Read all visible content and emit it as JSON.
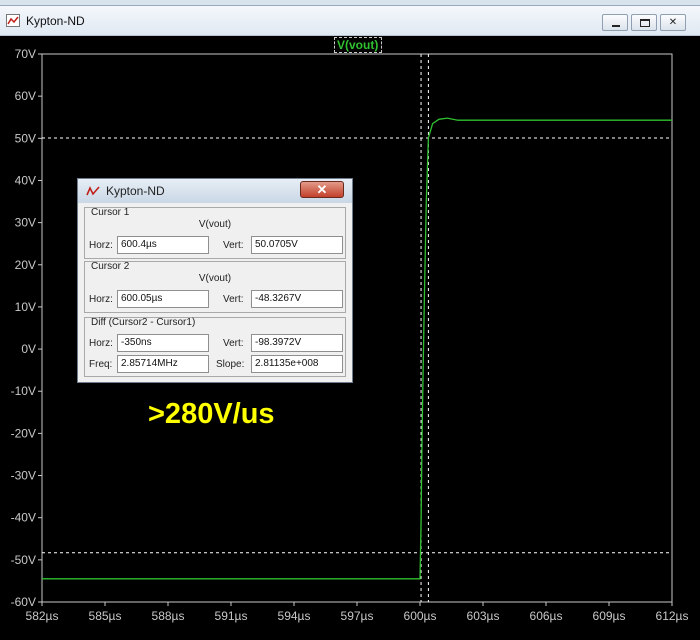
{
  "window": {
    "title": "Kypton-ND"
  },
  "window_buttons": {
    "minimize": "",
    "maximize": "",
    "close": "✕"
  },
  "trace_label": "V(vout)",
  "annotation": ">280V/us",
  "cursor_dialog": {
    "title": "Kypton-ND",
    "close_label": "✕",
    "cursor1": {
      "title": "Cursor 1",
      "trace": "V(vout)",
      "horz_label": "Horz:",
      "horz": "600.4µs",
      "vert_label": "Vert:",
      "vert": "50.0705V"
    },
    "cursor2": {
      "title": "Cursor 2",
      "trace": "V(vout)",
      "horz_label": "Horz:",
      "horz": "600.05µs",
      "vert_label": "Vert:",
      "vert": "-48.3267V"
    },
    "diff": {
      "title": "Diff (Cursor2 - Cursor1)",
      "horz_label": "Horz:",
      "horz": "-350ns",
      "vert_label": "Vert:",
      "vert": "-98.3972V",
      "freq_label": "Freq:",
      "freq": "2.85714MHz",
      "slope_label": "Slope:",
      "slope": "2.81135e+008"
    }
  },
  "colors": {
    "background": "#000000",
    "trace": "#30c030",
    "axis_text": "#c8c8c8",
    "annotation": "#ffff00",
    "cursor_line": "#ffffff"
  },
  "chart_data": {
    "type": "line",
    "title": "",
    "xlabel": "",
    "ylabel": "",
    "x_ticks": [
      "582µs",
      "585µs",
      "588µs",
      "591µs",
      "594µs",
      "597µs",
      "600µs",
      "603µs",
      "606µs",
      "609µs",
      "612µs"
    ],
    "y_ticks": [
      "70V",
      "60V",
      "50V",
      "40V",
      "30V",
      "20V",
      "10V",
      "0V",
      "-10V",
      "-20V",
      "-30V",
      "-40V",
      "-50V",
      "-60V"
    ],
    "xlim": [
      582,
      612
    ],
    "ylim": [
      -60,
      70
    ],
    "x_unit": "µs",
    "y_unit": "V",
    "grid": false,
    "series": [
      {
        "color": "#30c030",
        "x": [
          582,
          600.0,
          600.05,
          600.1,
          600.2,
          600.3,
          600.4,
          600.6,
          600.9,
          601.3,
          601.8,
          612
        ],
        "y": [
          -54.5,
          -54.5,
          -42,
          -20,
          10,
          35,
          50.1,
          53.5,
          54.5,
          54.8,
          54.3,
          54.3
        ]
      }
    ],
    "cursors": {
      "vertical_x": [
        600.05,
        600.4
      ],
      "horizontal_y": [
        50.07,
        -48.33
      ]
    }
  }
}
